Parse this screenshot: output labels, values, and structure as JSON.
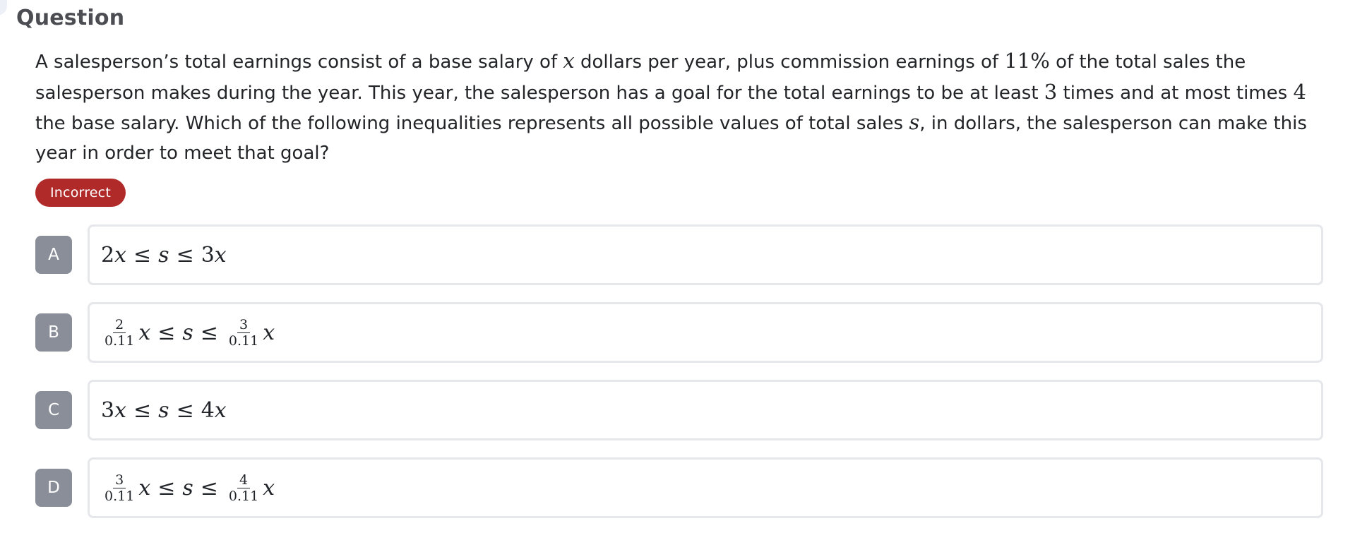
{
  "header": {
    "title": "Question"
  },
  "question": {
    "segments": [
      "A salesperson’s total earnings consist of a base salary of ",
      "x",
      " dollars per year, plus commission earnings of ",
      "11%",
      " of the total sales the salesperson makes during the year. This year, the salesperson has a goal for the total earnings to be at least ",
      "3",
      " times and at most times ",
      "4",
      " the base salary. Which of the following inequalities represents all possible values of total sales ",
      "s",
      ", in dollars, the salesperson can make this year in order to meet that goal?"
    ]
  },
  "status": {
    "label": "Incorrect",
    "color": "#b02a2a"
  },
  "options": [
    {
      "letter": "A",
      "left_coef": "2",
      "left_var": "x",
      "op1": "≤",
      "mid_var": "s",
      "op2": "≤",
      "right_coef": "3",
      "right_var": "x"
    },
    {
      "letter": "B",
      "left_num": "2",
      "left_den": "0.11",
      "left_var": "x",
      "op1": "≤",
      "mid_var": "s",
      "op2": "≤",
      "right_num": "3",
      "right_den": "0.11",
      "right_var": "x"
    },
    {
      "letter": "C",
      "left_coef": "3",
      "left_var": "x",
      "op1": "≤",
      "mid_var": "s",
      "op2": "≤",
      "right_coef": "4",
      "right_var": "x"
    },
    {
      "letter": "D",
      "left_num": "3",
      "left_den": "0.11",
      "left_var": "x",
      "op1": "≤",
      "mid_var": "s",
      "op2": "≤",
      "right_num": "4",
      "right_den": "0.11",
      "right_var": "x"
    }
  ],
  "colors": {
    "badge_bg": "#b02a2a",
    "letter_bg": "#8a8e98",
    "card_border": "#e5e7eb",
    "heading_text": "#4b4d52"
  }
}
